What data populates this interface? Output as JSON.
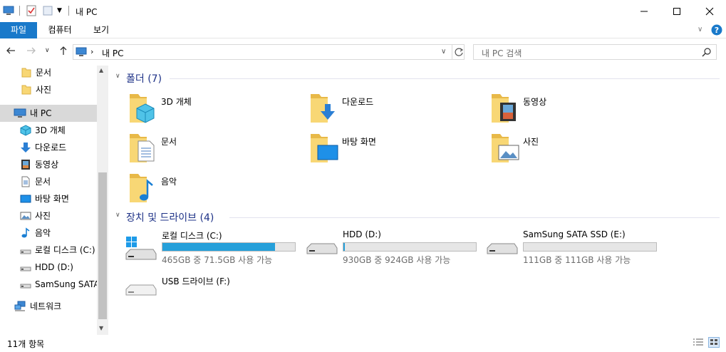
{
  "window": {
    "title": "내 PC",
    "minimize_icon": "minimize-icon",
    "maximize_icon": "maximize-icon",
    "close_icon": "close-icon"
  },
  "ribbon": {
    "tabs": [
      "파일",
      "컴퓨터",
      "보기"
    ],
    "active_tab_color": "#1979ca"
  },
  "address": {
    "path": "내 PC",
    "search_placeholder": "내 PC 검색"
  },
  "sidebar": {
    "items": [
      {
        "label": "문서",
        "icon": "folder-icon"
      },
      {
        "label": "사진",
        "icon": "folder-icon"
      },
      {
        "label": "내 PC",
        "icon": "computer-icon"
      },
      {
        "label": "3D 개체",
        "icon": "3d-objects-icon"
      },
      {
        "label": "다운로드",
        "icon": "download-icon"
      },
      {
        "label": "동영상",
        "icon": "video-icon"
      },
      {
        "label": "문서",
        "icon": "document-icon"
      },
      {
        "label": "바탕 화면",
        "icon": "desktop-icon"
      },
      {
        "label": "사진",
        "icon": "picture-icon"
      },
      {
        "label": "음악",
        "icon": "music-icon"
      },
      {
        "label": "로컬 디스크 (C:)",
        "icon": "drive-icon"
      },
      {
        "label": "HDD (D:)",
        "icon": "drive-icon"
      },
      {
        "label": "SamSung SATA",
        "icon": "drive-icon"
      },
      {
        "label": "네트워크",
        "icon": "network-icon"
      }
    ]
  },
  "folders_group": {
    "header": "폴더 (7)",
    "items": [
      {
        "label": "3D 개체",
        "icon": "3d-objects-icon"
      },
      {
        "label": "다운로드",
        "icon": "download-icon"
      },
      {
        "label": "동영상",
        "icon": "video-icon"
      },
      {
        "label": "문서",
        "icon": "document-icon"
      },
      {
        "label": "바탕 화면",
        "icon": "desktop-icon"
      },
      {
        "label": "사진",
        "icon": "picture-icon"
      },
      {
        "label": "음악",
        "icon": "music-icon"
      }
    ]
  },
  "drives_group": {
    "header": "장치 및 드라이브 (4)",
    "items": [
      {
        "label": "로컬 디스크 (C:)",
        "free": "465GB 중 71.5GB 사용 가능",
        "used_fraction": 0.85,
        "icon": "windows-drive-icon"
      },
      {
        "label": "HDD (D:)",
        "free": "930GB 중 924GB 사용 가능",
        "used_fraction": 0.01,
        "icon": "drive-icon"
      },
      {
        "label": "SamSung SATA SSD (E:)",
        "free": "111GB 중 111GB 사용 가능",
        "used_fraction": 0.0,
        "icon": "drive-icon"
      },
      {
        "label": "USB 드라이브 (F:)",
        "icon": "usb-drive-icon"
      }
    ]
  },
  "status": {
    "count": "11개 항목"
  },
  "colors": {
    "accent": "#1979ca",
    "selection": "#d9d9d9",
    "bar_fill": "#26a0da",
    "group_header": "#1e3287"
  }
}
